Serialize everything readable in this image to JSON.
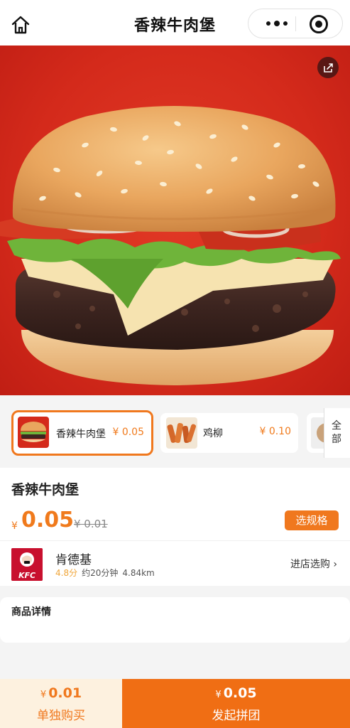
{
  "navbar": {
    "title": "香辣牛肉堡",
    "home_icon": "home-icon",
    "more_icon": "more-dots-icon",
    "close_icon": "miniprogram-close-icon"
  },
  "hero": {
    "image": "spicy-beef-burger-photo",
    "share_icon": "share-icon"
  },
  "variants": [
    {
      "name": "香辣牛肉堡",
      "price": "¥ 0.05",
      "selected": true,
      "thumb": "burger-thumbnail"
    },
    {
      "name": "鸡柳",
      "price": "¥ 0.10",
      "selected": false,
      "thumb": "chicken-strips-thumbnail"
    }
  ],
  "variants_all": "全部",
  "product": {
    "name": "香辣牛肉堡",
    "currency": "¥",
    "price": "0.05",
    "original_price": "¥ 0.01",
    "spec_button": "选规格"
  },
  "store": {
    "logo_text": "KFC",
    "name": "肯德基",
    "rating": "4.8分",
    "delivery_time": "约20分钟",
    "distance": "4.84km",
    "enter_label": "进店选购 ›"
  },
  "details": {
    "title": "商品详情"
  },
  "bottom_bar": {
    "solo": {
      "currency": "¥",
      "price": "0.01",
      "label": "单独购买"
    },
    "group": {
      "currency": "¥",
      "price": "0.05",
      "label": "发起拼团"
    }
  },
  "colors": {
    "accent": "#f0781e",
    "group_button": "#f06e14",
    "solo_button_bg": "#fdf1df",
    "hero_bg": "#d42a1b",
    "rating": "#f0a63a"
  }
}
